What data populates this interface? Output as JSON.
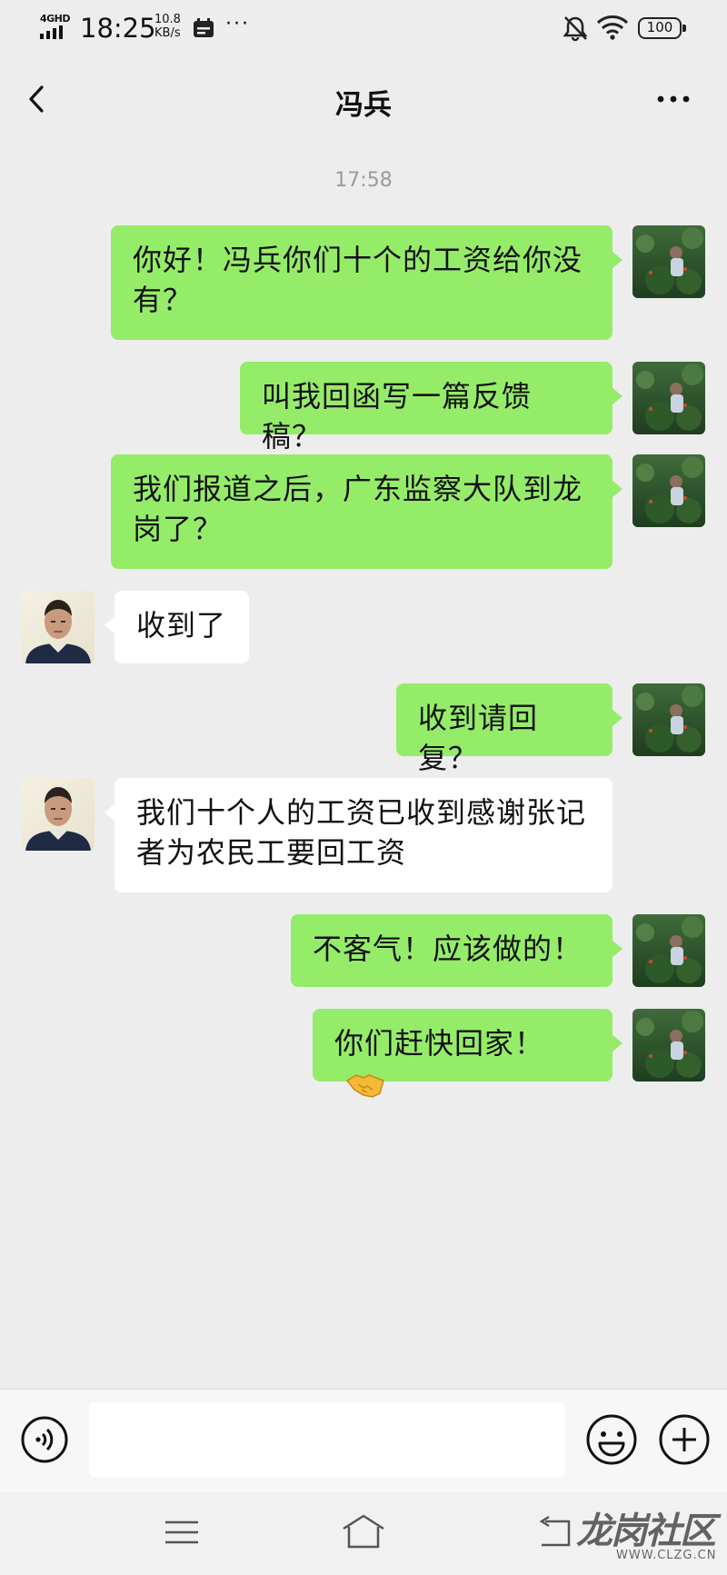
{
  "status_bar": {
    "network": "4GHD",
    "time": "18:25",
    "speed_value": "10.8",
    "speed_unit": "KB/s",
    "more": "···",
    "battery": "100",
    "icons": [
      "signal-icon",
      "calendar-icon",
      "mute-bell-icon",
      "wifi-icon",
      "battery-icon"
    ]
  },
  "navbar": {
    "title": "冯兵",
    "back_icon": "chevron-left-icon",
    "more_icon": "more-dots-icon"
  },
  "chat": {
    "timestamp": "17:58",
    "messages": [
      {
        "sender": "me",
        "text": "你好！冯兵你们十个的工资给你没有？"
      },
      {
        "sender": "me",
        "text": "叫我回函写一篇反馈稿？"
      },
      {
        "sender": "me",
        "text": "我们报道之后，广东监察大队到龙岗了？"
      },
      {
        "sender": "other",
        "text": "收到了"
      },
      {
        "sender": "me",
        "text": "收到请回复？"
      },
      {
        "sender": "other",
        "text": "我们十个人的工资已收到感谢张记者为农民工要回工资"
      },
      {
        "sender": "me",
        "text": "不客气！应该做的！"
      },
      {
        "sender": "me",
        "text": "你们赶快回家！",
        "emoji": "handshake-emoji"
      }
    ]
  },
  "input_bar": {
    "value": "",
    "icons": [
      "voice-icon",
      "emoji-icon",
      "plus-icon"
    ]
  },
  "system_nav": {
    "icons": [
      "menu-icon",
      "home-icon",
      "back-icon"
    ]
  },
  "watermark": {
    "text": "龙岗社区",
    "sub": "WWW.CLZG.CN"
  },
  "colors": {
    "background": "#ededed",
    "my_bubble": "#95ec69",
    "their_bubble": "#ffffff",
    "timestamp": "#9a9a9a"
  }
}
